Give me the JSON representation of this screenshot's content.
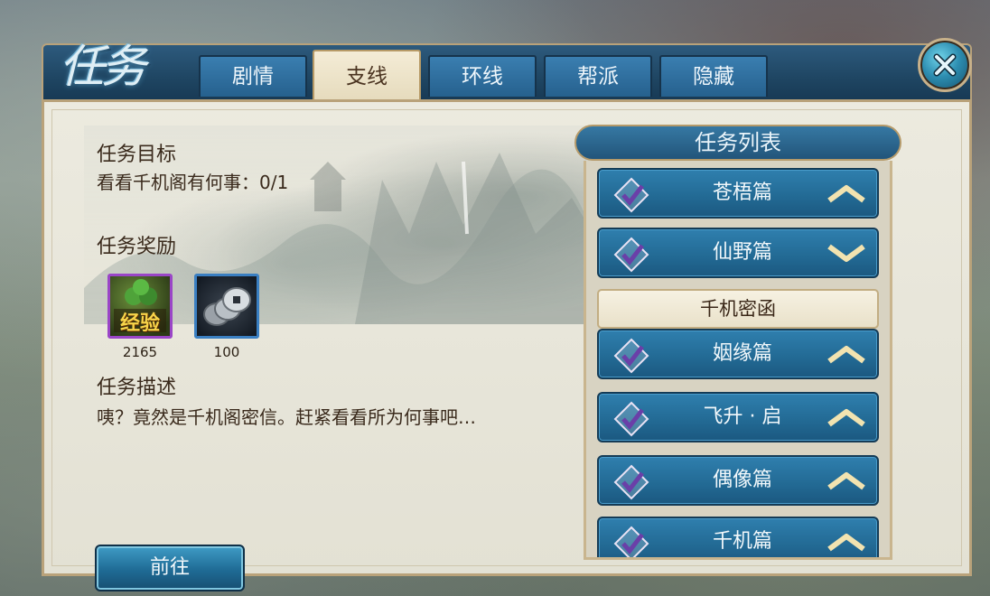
{
  "window": {
    "title_glyph": "任务"
  },
  "tabs": [
    {
      "label": "剧情",
      "active": false
    },
    {
      "label": "支线",
      "active": true
    },
    {
      "label": "环线",
      "active": false
    },
    {
      "label": "帮派",
      "active": false
    },
    {
      "label": "隐藏",
      "active": false
    }
  ],
  "detail": {
    "goal_heading": "任务目标",
    "goal_text": "看看千机阁有何事：0/1",
    "reward_heading": "任务奖励",
    "rewards": [
      {
        "label": "经验",
        "amount": "2165",
        "icon": "exp-icon"
      },
      {
        "label": "",
        "amount": "100",
        "icon": "coin-stack-icon"
      }
    ],
    "desc_heading": "任务描述",
    "desc_text": "咦？竟然是千机阁密信。赶紧看看所为何事吧…",
    "goto_label": "前往"
  },
  "quest_list": {
    "header": "任务列表",
    "items": [
      {
        "label": "苍梧篇",
        "expanded": false
      },
      {
        "label": "仙野篇",
        "expanded": true
      },
      {
        "label": "千机密函",
        "sub": true
      },
      {
        "label": "姻缘篇",
        "expanded": false
      },
      {
        "label": "飞升 · 启",
        "expanded": false
      },
      {
        "label": "偶像篇",
        "expanded": false
      },
      {
        "label": "千机篇",
        "expanded": false
      }
    ]
  },
  "colors": {
    "tab_active_bg": "#f0e7cf",
    "tab_bg": "#2f6f9e",
    "panel_bg": "#e8e6db",
    "item_blue": "#2a74a3",
    "check_purple": "#6a3fa8",
    "chevron_gold": "#f2e3b0"
  }
}
